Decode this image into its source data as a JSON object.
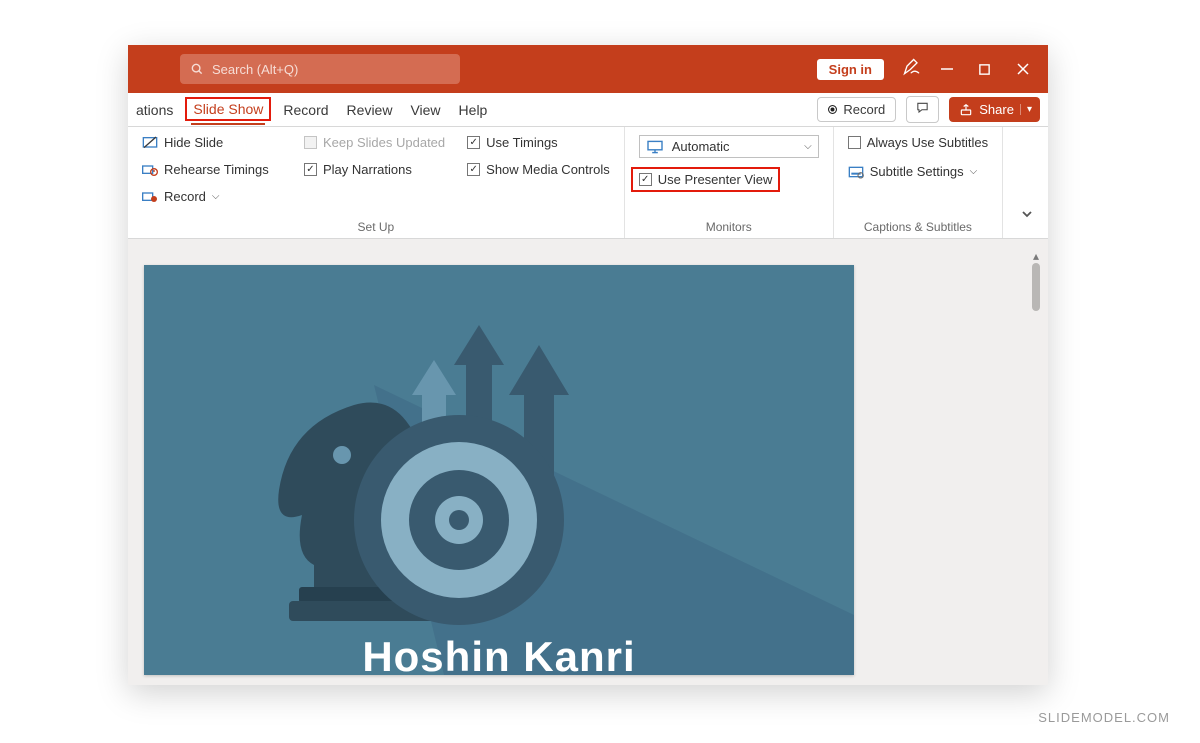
{
  "titlebar": {
    "search_placeholder": "Search (Alt+Q)",
    "signin_label": "Sign in"
  },
  "tabs": {
    "partial": "ations",
    "items": [
      "Slide Show",
      "Record",
      "Review",
      "View",
      "Help"
    ],
    "record_label": "Record",
    "share_label": "Share"
  },
  "ribbon": {
    "setup": {
      "hide_slide": "Hide Slide",
      "rehearse": "Rehearse Timings",
      "record": "Record",
      "keep_updated": "Keep Slides Updated",
      "play_narrations": "Play Narrations",
      "use_timings": "Use Timings",
      "show_media": "Show Media Controls",
      "label": "Set Up"
    },
    "monitors": {
      "select_value": "Automatic",
      "presenter_view": "Use Presenter View",
      "label": "Monitors"
    },
    "captions": {
      "always_subs": "Always Use Subtitles",
      "subtitle_settings": "Subtitle Settings",
      "label": "Captions & Subtitles"
    }
  },
  "slide": {
    "title": "Hoshin Kanri"
  },
  "watermark": "SLIDEMODEL.COM"
}
